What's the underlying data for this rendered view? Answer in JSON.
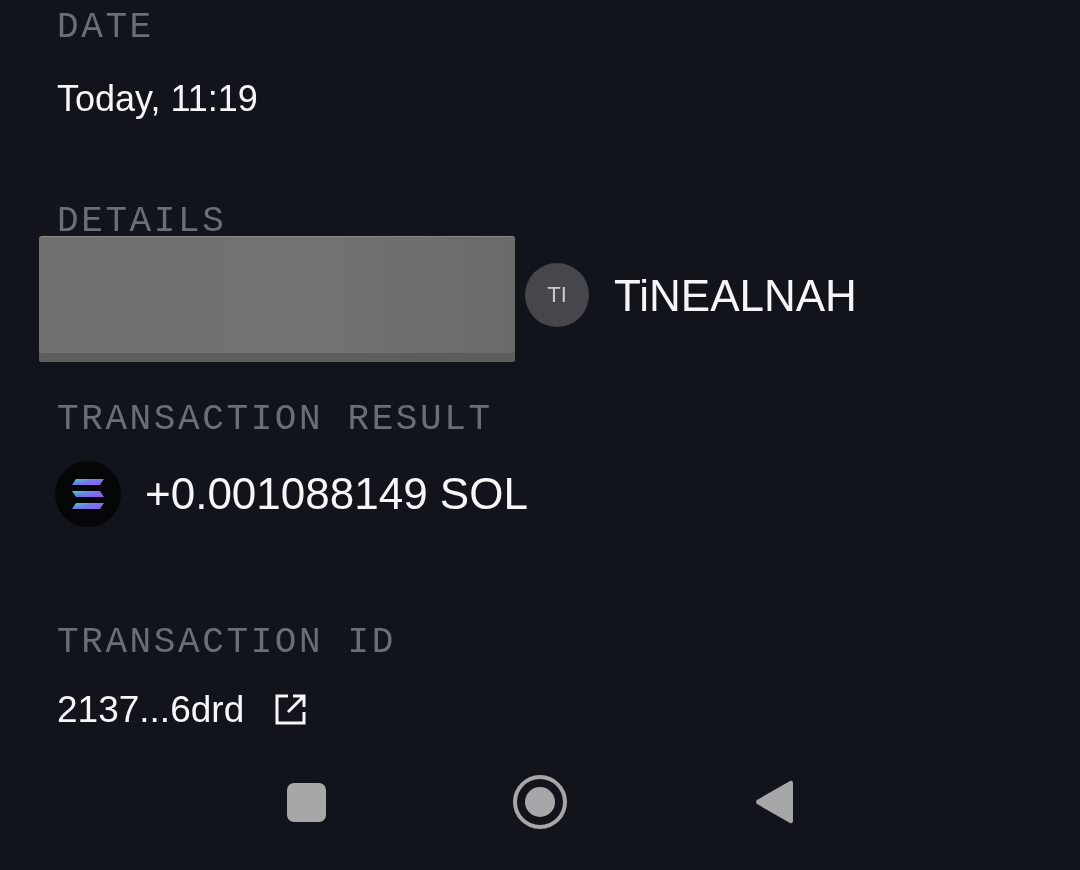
{
  "sections": [
    {
      "kind": "text",
      "label": "DATE",
      "value": "Today, 11:19"
    },
    {
      "kind": "party",
      "label": "DETAILS",
      "redacted": true,
      "avatar_initials": "TI",
      "name": "TiNEALNAH"
    },
    {
      "kind": "amount",
      "label": "TRANSACTION RESULT",
      "amount": "+0.001088149 SOL"
    },
    {
      "kind": "link",
      "label": "TRANSACTION ID",
      "value": "2137...6drd"
    }
  ],
  "nav_bar": {
    "buttons": [
      {
        "kind": "recents"
      },
      {
        "kind": "home"
      },
      {
        "kind": "back"
      }
    ]
  }
}
